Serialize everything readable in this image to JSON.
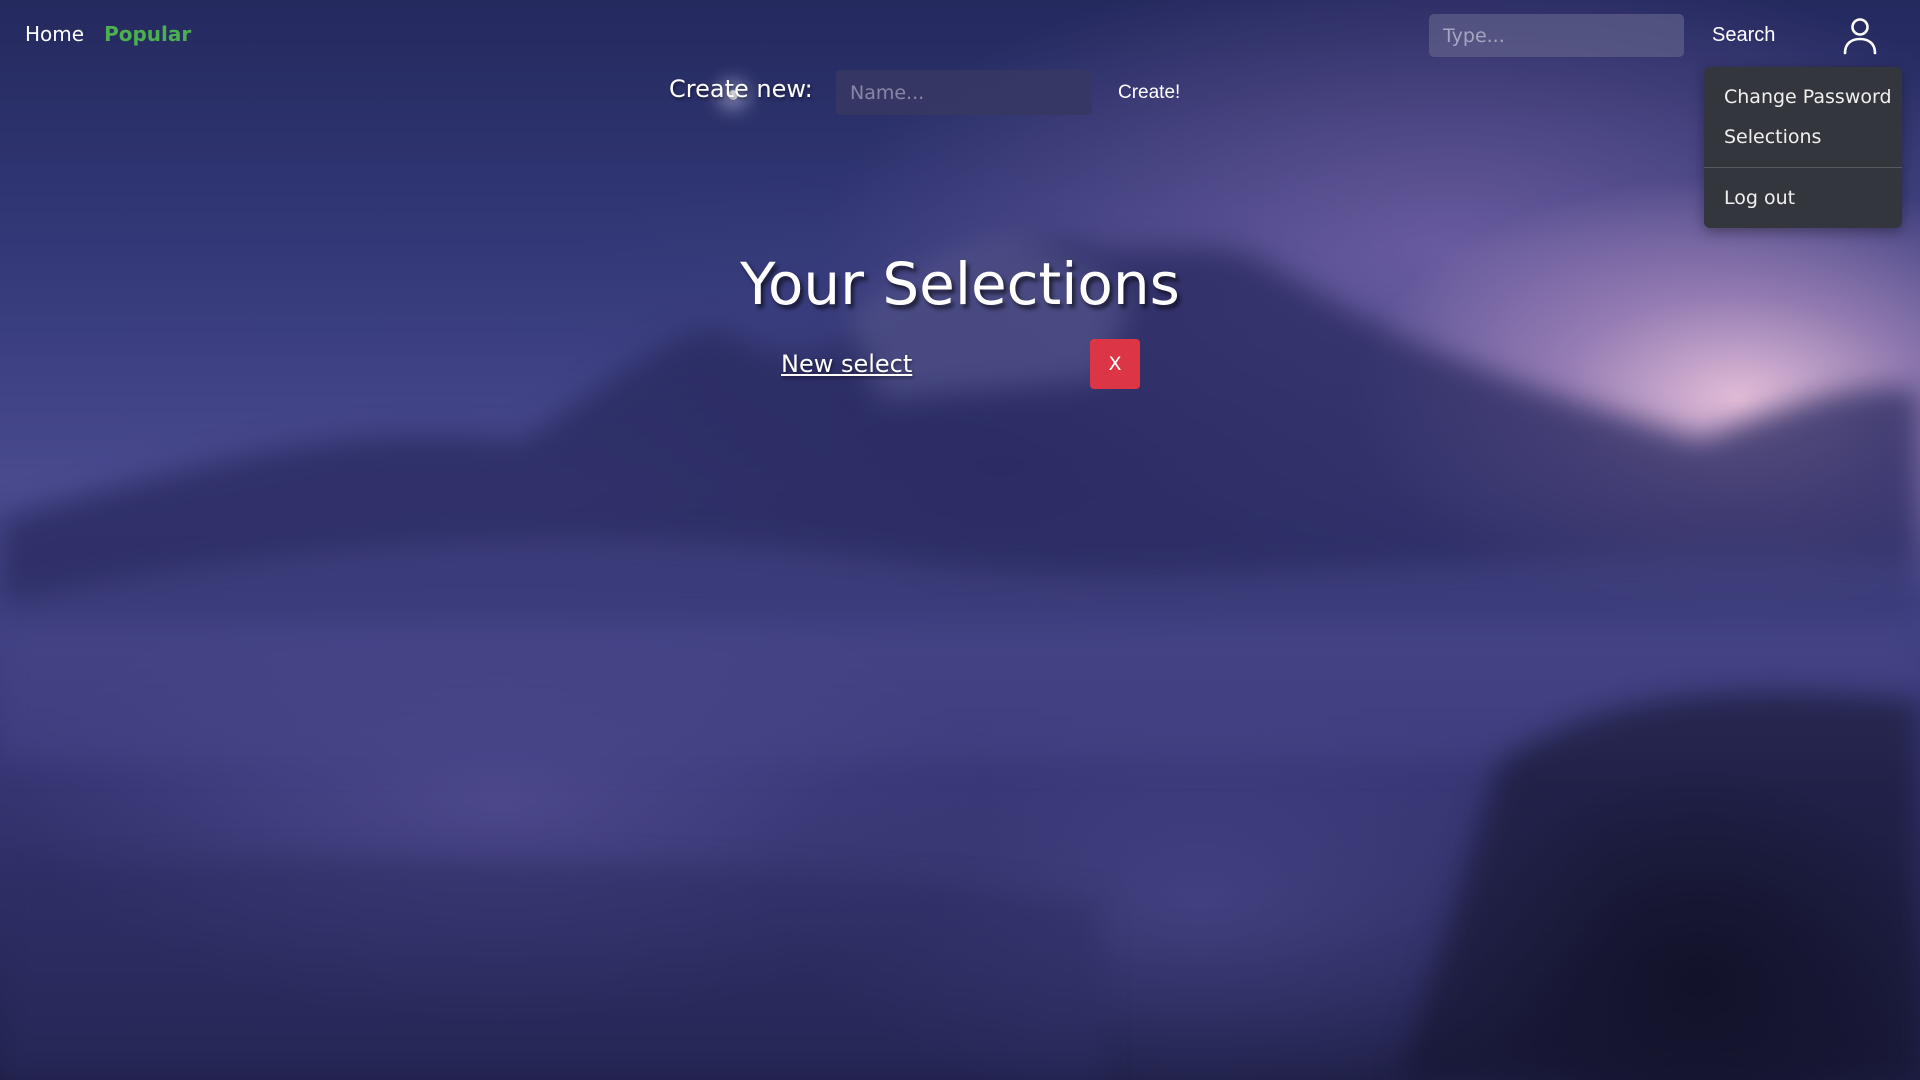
{
  "nav": {
    "home_label": "Home",
    "popular_label": "Popular"
  },
  "search": {
    "placeholder": "Type...",
    "button_label": "Search"
  },
  "user_menu": {
    "icon": "user-icon",
    "items": [
      {
        "label": "Change Password"
      },
      {
        "label": "Selections"
      },
      {
        "label": "Log out"
      }
    ]
  },
  "create": {
    "label": "Create new:",
    "name_placeholder": "Name...",
    "button_label": "Create!"
  },
  "main": {
    "title": "Your Selections",
    "selections": [
      {
        "name": "New select",
        "delete_label": "X"
      }
    ]
  },
  "colors": {
    "popular_link": "#4caf50",
    "delete_button": "#dc3545",
    "dropdown_bg": "#33363c"
  }
}
